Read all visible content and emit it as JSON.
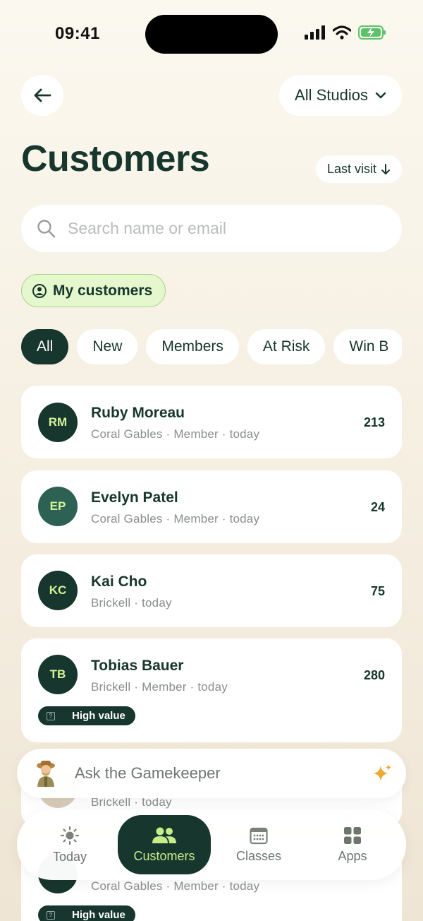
{
  "status": {
    "time": "09:41"
  },
  "header": {
    "back": "Back",
    "studio": "All Studios"
  },
  "page": {
    "title": "Customers",
    "sort": "Last visit"
  },
  "search": {
    "placeholder": "Search name or email"
  },
  "my_customers": "My customers",
  "filters": [
    "All",
    "New",
    "Members",
    "At Risk",
    "Win B"
  ],
  "customers": [
    {
      "initials": "RM",
      "name": "Ruby Moreau",
      "sub": "Coral Gables · Member · today",
      "count": "213"
    },
    {
      "initials": "EP",
      "name": "Evelyn Patel",
      "sub": "Coral Gables · Member · today",
      "count": "24"
    },
    {
      "initials": "KC",
      "name": "Kai Cho",
      "sub": "Brickell · today",
      "count": "75"
    },
    {
      "initials": "TB",
      "name": "Tobias Bauer",
      "sub": "Brickell · Member · today",
      "count": "280",
      "badge": "High value"
    },
    {
      "sub": "Brickell · today"
    },
    {
      "sub": "Coral Gables · Member · today",
      "badge": "High value"
    }
  ],
  "assistant": {
    "label": "Ask the Gamekeeper"
  },
  "tabs": [
    "Today",
    "Customers",
    "Classes",
    "Apps"
  ],
  "colors": {
    "primary": "#17362d",
    "accent_light": "#d6f59a",
    "chip_green_bg": "#e5f7cd",
    "sparkle": "#f0a830"
  }
}
